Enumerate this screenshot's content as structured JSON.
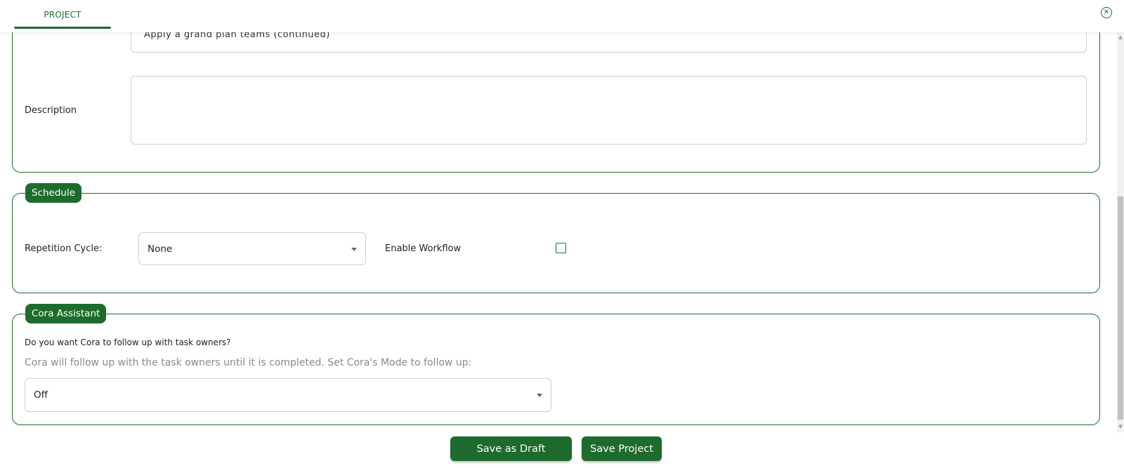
{
  "header": {
    "tab_label": "PROJECT",
    "close_icon": "close-circle-icon"
  },
  "details": {
    "name_value_partial": "Apply a grand plan teams (continued)",
    "description_label": "Description",
    "description_value": ""
  },
  "schedule": {
    "legend": "Schedule",
    "repetition_label": "Repetition Cycle:",
    "repetition_value": "None",
    "workflow_label": "Enable Workflow",
    "workflow_checked": false
  },
  "cora": {
    "legend": "Cora Assistant",
    "question": "Do you want Cora to follow up with task owners?",
    "hint": "Cora will follow up with the task owners until it is completed. Set Cora's Mode to follow up:",
    "mode_value": "Off"
  },
  "actions": {
    "save_draft": "Save as Draft",
    "save_project": "Save Project"
  },
  "colors": {
    "accent": "#1e6b2e",
    "border": "#cfcfcf",
    "muted_text": "#8a8a8a"
  }
}
